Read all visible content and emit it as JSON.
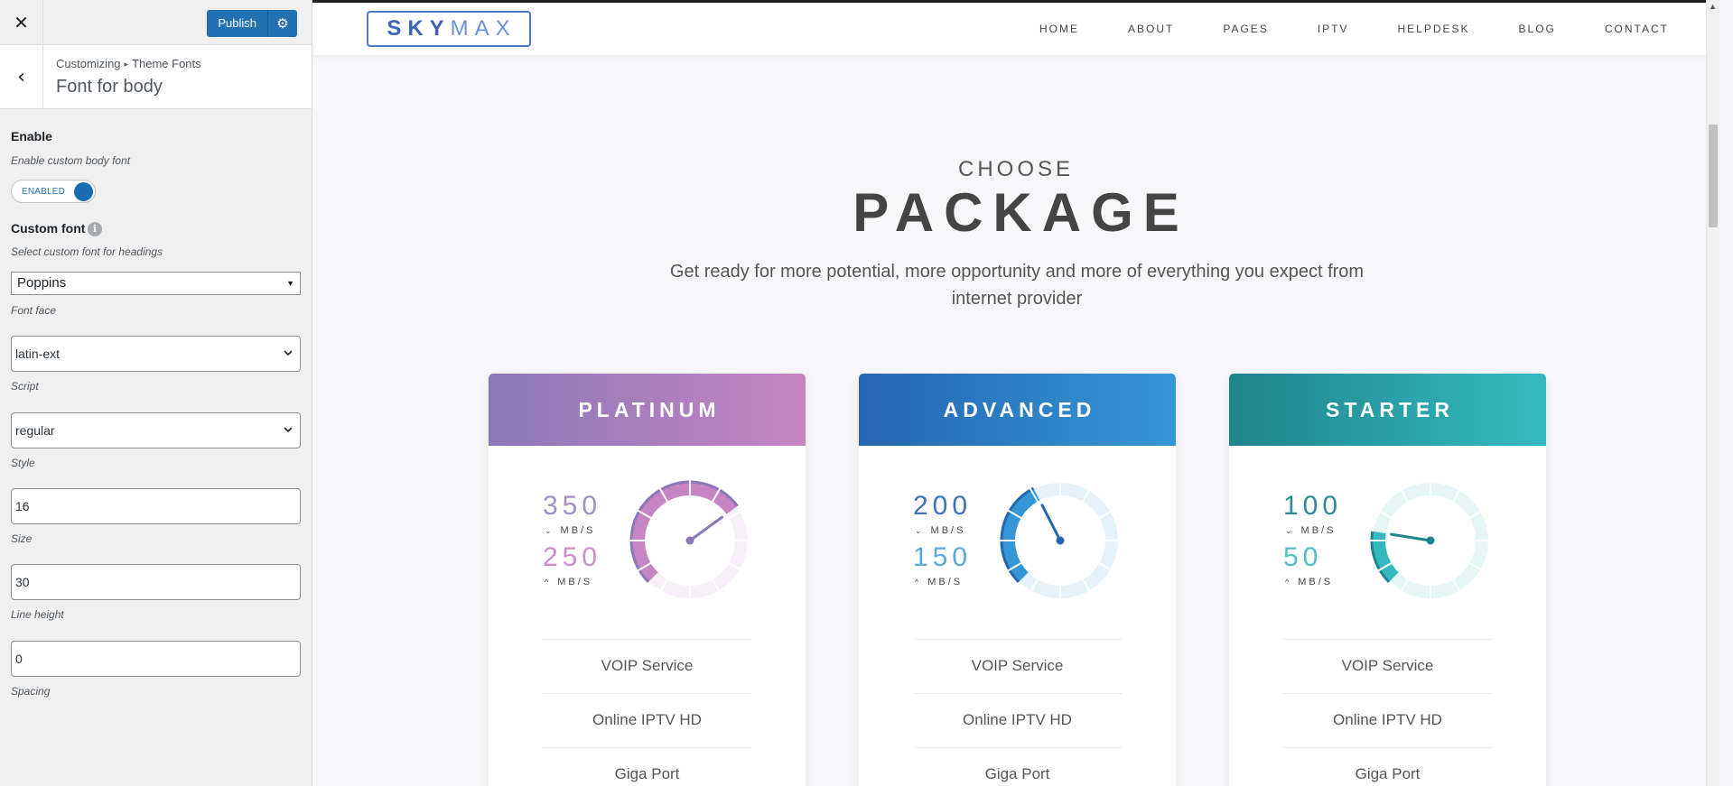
{
  "customizer": {
    "close_icon": "close-icon",
    "publish_label": "Publish",
    "breadcrumb_root": "Customizing",
    "breadcrumb_section": "Theme Fonts",
    "section_title": "Font for body",
    "enable_label": "Enable",
    "enable_desc": "Enable custom body font",
    "toggle_label": "ENABLED",
    "toggle_on": true,
    "custom_font_label": "Custom font",
    "custom_font_desc": "Select custom font for headings",
    "font_value": "Poppins",
    "font_face_desc": "Font face",
    "script_value": "latin-ext",
    "script_desc": "Script",
    "style_value": "regular",
    "style_desc": "Style",
    "size_value": "16",
    "size_desc": "Size",
    "line_height_value": "30",
    "line_height_desc": "Line height",
    "spacing_value": "0",
    "spacing_desc": "Spacing",
    "accent_color": "#2271b1"
  },
  "site": {
    "logo_part1": "SKY",
    "logo_part2": "MAX",
    "nav": [
      "HOME",
      "ABOUT",
      "PAGES",
      "IPTV",
      "HELPDESK",
      "BLOG",
      "CONTACT"
    ],
    "heading_small": "CHOOSE",
    "heading_big": "PACKAGE",
    "tagline": "Get ready for more potential, more opportunity and more of everything you expect from internet provider",
    "unit_label": "MB/S",
    "packages": [
      {
        "name": "PLATINUM",
        "download": "350",
        "upload": "250",
        "gauge_level": 0.7,
        "color_a": "#8b78b8",
        "color_b": "#c684c2",
        "download_color": "#a28fc5",
        "upload_color": "#d08ccf",
        "features": [
          "VOIP Service",
          "Online IPTV HD",
          "Giga Port"
        ]
      },
      {
        "name": "ADVANCED",
        "download": "200",
        "upload": "150",
        "gauge_level": 0.4,
        "color_a": "#2566b0",
        "color_b": "#3597d6",
        "download_color": "#3d74b8",
        "upload_color": "#5aa9dd",
        "features": [
          "VOIP Service",
          "Online IPTV HD",
          "Giga Port"
        ]
      },
      {
        "name": "STARTER",
        "download": "100",
        "upload": "50",
        "gauge_level": 0.2,
        "color_a": "#1e858c",
        "color_b": "#35b9c0",
        "download_color": "#2d8d94",
        "upload_color": "#4fc1c7",
        "features": [
          "VOIP Service",
          "Online IPTV HD",
          "Giga Port"
        ]
      }
    ]
  }
}
